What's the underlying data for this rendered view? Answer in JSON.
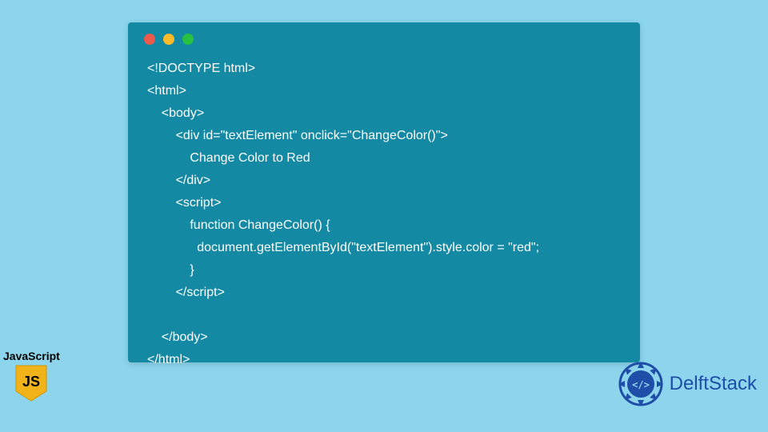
{
  "code_window": {
    "traffic_lights": [
      "red",
      "yellow",
      "green"
    ],
    "lines": [
      "<!DOCTYPE html>",
      "<html>",
      "    <body>",
      "        <div id=\"textElement\" onclick=\"ChangeColor()\">",
      "            Change Color to Red",
      "        </div>",
      "        <script>",
      "            function ChangeColor() {",
      "              document.getElementById(\"textElement\").style.color = \"red\";",
      "            }",
      "        </script>",
      "",
      "    </body>",
      "</html>"
    ]
  },
  "js_badge": {
    "label": "JavaScript",
    "icon_text": "JS",
    "icon_bg": "#f0b41a",
    "icon_fg": "#000000"
  },
  "brand": {
    "name": "DelftStack",
    "accent": "#1e4ea7"
  }
}
